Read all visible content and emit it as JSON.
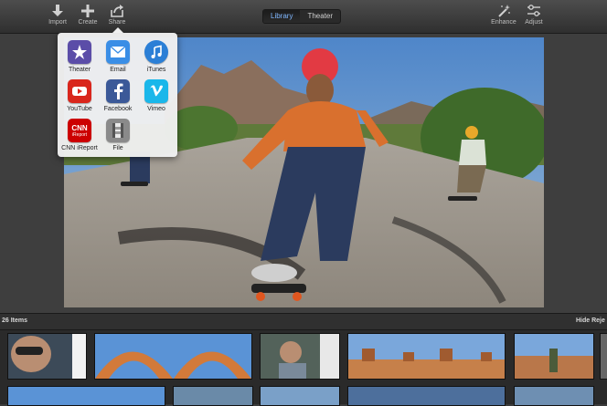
{
  "toolbar": {
    "import_label": "Import",
    "create_label": "Create",
    "share_label": "Share",
    "enhance_label": "Enhance",
    "adjust_label": "Adjust",
    "tabs": [
      {
        "label": "Library",
        "active": true
      },
      {
        "label": "Theater",
        "active": false
      }
    ]
  },
  "share_menu": {
    "items": [
      {
        "label": "Theater",
        "icon": "theater-icon",
        "color": "#5b4da8"
      },
      {
        "label": "Email",
        "icon": "mail-icon",
        "color": "#3a8ee6"
      },
      {
        "label": "iTunes",
        "icon": "itunes-icon",
        "color": "#2b7fd6"
      },
      {
        "label": "YouTube",
        "icon": "youtube-icon",
        "color": "#d9261c"
      },
      {
        "label": "Facebook",
        "icon": "facebook-icon",
        "color": "#3b5998"
      },
      {
        "label": "Vimeo",
        "icon": "vimeo-icon",
        "color": "#1ab7ea"
      },
      {
        "label": "CNN iReport",
        "icon": "cnn-ireport-icon",
        "color": "#cc0000"
      },
      {
        "label": "File",
        "icon": "file-icon",
        "color": "#8a8a8a"
      }
    ],
    "cnn_text": "CNN",
    "ireport_text": "iReport"
  },
  "browser": {
    "item_count": "26 Items",
    "hide_label": "Hide Reje"
  },
  "colors": {
    "accent": "#7fb7ff",
    "toolbar": "#3d3d3d",
    "popover": "#f0f0f0"
  }
}
